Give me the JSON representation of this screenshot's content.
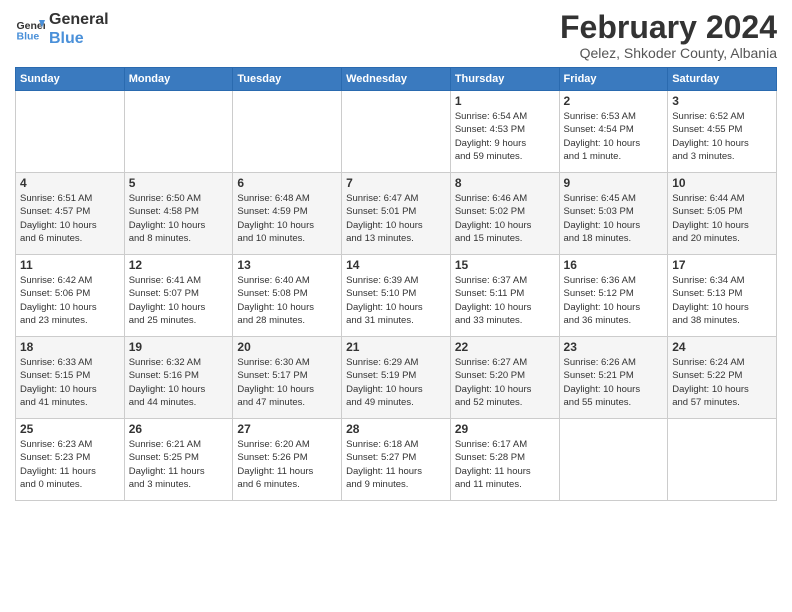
{
  "header": {
    "logo_line1": "General",
    "logo_line2": "Blue",
    "month": "February 2024",
    "location": "Qelez, Shkoder County, Albania"
  },
  "weekdays": [
    "Sunday",
    "Monday",
    "Tuesday",
    "Wednesday",
    "Thursday",
    "Friday",
    "Saturday"
  ],
  "weeks": [
    [
      {
        "day": "",
        "detail": ""
      },
      {
        "day": "",
        "detail": ""
      },
      {
        "day": "",
        "detail": ""
      },
      {
        "day": "",
        "detail": ""
      },
      {
        "day": "1",
        "detail": "Sunrise: 6:54 AM\nSunset: 4:53 PM\nDaylight: 9 hours\nand 59 minutes."
      },
      {
        "day": "2",
        "detail": "Sunrise: 6:53 AM\nSunset: 4:54 PM\nDaylight: 10 hours\nand 1 minute."
      },
      {
        "day": "3",
        "detail": "Sunrise: 6:52 AM\nSunset: 4:55 PM\nDaylight: 10 hours\nand 3 minutes."
      }
    ],
    [
      {
        "day": "4",
        "detail": "Sunrise: 6:51 AM\nSunset: 4:57 PM\nDaylight: 10 hours\nand 6 minutes."
      },
      {
        "day": "5",
        "detail": "Sunrise: 6:50 AM\nSunset: 4:58 PM\nDaylight: 10 hours\nand 8 minutes."
      },
      {
        "day": "6",
        "detail": "Sunrise: 6:48 AM\nSunset: 4:59 PM\nDaylight: 10 hours\nand 10 minutes."
      },
      {
        "day": "7",
        "detail": "Sunrise: 6:47 AM\nSunset: 5:01 PM\nDaylight: 10 hours\nand 13 minutes."
      },
      {
        "day": "8",
        "detail": "Sunrise: 6:46 AM\nSunset: 5:02 PM\nDaylight: 10 hours\nand 15 minutes."
      },
      {
        "day": "9",
        "detail": "Sunrise: 6:45 AM\nSunset: 5:03 PM\nDaylight: 10 hours\nand 18 minutes."
      },
      {
        "day": "10",
        "detail": "Sunrise: 6:44 AM\nSunset: 5:05 PM\nDaylight: 10 hours\nand 20 minutes."
      }
    ],
    [
      {
        "day": "11",
        "detail": "Sunrise: 6:42 AM\nSunset: 5:06 PM\nDaylight: 10 hours\nand 23 minutes."
      },
      {
        "day": "12",
        "detail": "Sunrise: 6:41 AM\nSunset: 5:07 PM\nDaylight: 10 hours\nand 25 minutes."
      },
      {
        "day": "13",
        "detail": "Sunrise: 6:40 AM\nSunset: 5:08 PM\nDaylight: 10 hours\nand 28 minutes."
      },
      {
        "day": "14",
        "detail": "Sunrise: 6:39 AM\nSunset: 5:10 PM\nDaylight: 10 hours\nand 31 minutes."
      },
      {
        "day": "15",
        "detail": "Sunrise: 6:37 AM\nSunset: 5:11 PM\nDaylight: 10 hours\nand 33 minutes."
      },
      {
        "day": "16",
        "detail": "Sunrise: 6:36 AM\nSunset: 5:12 PM\nDaylight: 10 hours\nand 36 minutes."
      },
      {
        "day": "17",
        "detail": "Sunrise: 6:34 AM\nSunset: 5:13 PM\nDaylight: 10 hours\nand 38 minutes."
      }
    ],
    [
      {
        "day": "18",
        "detail": "Sunrise: 6:33 AM\nSunset: 5:15 PM\nDaylight: 10 hours\nand 41 minutes."
      },
      {
        "day": "19",
        "detail": "Sunrise: 6:32 AM\nSunset: 5:16 PM\nDaylight: 10 hours\nand 44 minutes."
      },
      {
        "day": "20",
        "detail": "Sunrise: 6:30 AM\nSunset: 5:17 PM\nDaylight: 10 hours\nand 47 minutes."
      },
      {
        "day": "21",
        "detail": "Sunrise: 6:29 AM\nSunset: 5:19 PM\nDaylight: 10 hours\nand 49 minutes."
      },
      {
        "day": "22",
        "detail": "Sunrise: 6:27 AM\nSunset: 5:20 PM\nDaylight: 10 hours\nand 52 minutes."
      },
      {
        "day": "23",
        "detail": "Sunrise: 6:26 AM\nSunset: 5:21 PM\nDaylight: 10 hours\nand 55 minutes."
      },
      {
        "day": "24",
        "detail": "Sunrise: 6:24 AM\nSunset: 5:22 PM\nDaylight: 10 hours\nand 57 minutes."
      }
    ],
    [
      {
        "day": "25",
        "detail": "Sunrise: 6:23 AM\nSunset: 5:23 PM\nDaylight: 11 hours\nand 0 minutes."
      },
      {
        "day": "26",
        "detail": "Sunrise: 6:21 AM\nSunset: 5:25 PM\nDaylight: 11 hours\nand 3 minutes."
      },
      {
        "day": "27",
        "detail": "Sunrise: 6:20 AM\nSunset: 5:26 PM\nDaylight: 11 hours\nand 6 minutes."
      },
      {
        "day": "28",
        "detail": "Sunrise: 6:18 AM\nSunset: 5:27 PM\nDaylight: 11 hours\nand 9 minutes."
      },
      {
        "day": "29",
        "detail": "Sunrise: 6:17 AM\nSunset: 5:28 PM\nDaylight: 11 hours\nand 11 minutes."
      },
      {
        "day": "",
        "detail": ""
      },
      {
        "day": "",
        "detail": ""
      }
    ]
  ]
}
